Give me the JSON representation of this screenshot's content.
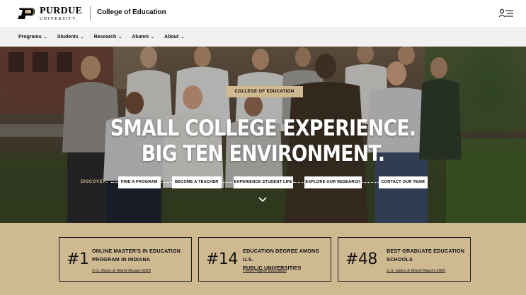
{
  "header": {
    "logo_word": "PURDUE",
    "logo_sub": "UNIVERSITY.",
    "college_name": "College of Education",
    "menu_icon": "user-menu-icon"
  },
  "nav": {
    "items": [
      {
        "label": "Programs"
      },
      {
        "label": "Students"
      },
      {
        "label": "Research"
      },
      {
        "label": "Alumni"
      },
      {
        "label": "About"
      }
    ]
  },
  "hero": {
    "badge": "COLLEGE OF EDUCATION",
    "headline_1": "SMALL COLLEGE EXPERIENCE.",
    "headline_2": "BIG TEN ENVIRONMENT.",
    "discover_label": "DISCOVER:",
    "ctas": [
      {
        "label": "FIND A PROGRAM"
      },
      {
        "label": "BECOME A TEACHER"
      },
      {
        "label": "EXPERIENCE STUDENT LIFE"
      },
      {
        "label": "EXPLORE OUR RESEARCH"
      },
      {
        "label": "CONTACT OUR TEAM"
      }
    ]
  },
  "stats": [
    {
      "number": "#1",
      "title_1": "ONLINE MASTER'S IN EDUCATION",
      "title_2": "PROGRAM IN INDIANA",
      "source": "U.S. News & World Report 2025"
    },
    {
      "number": "#14",
      "title_1": "EDUCATION DEGREE AMONG U.S.",
      "title_2": "PUBLIC UNIVERSITIES",
      "source": "Times Higher Education"
    },
    {
      "number": "#48",
      "title_1": "BEST GRADUATE EDUCATION",
      "title_2": "SCHOOLS",
      "source": "U.S. News & World Report 2025"
    }
  ],
  "colors": {
    "gold": "#cfb991",
    "nav_bg": "#f1f1f1",
    "text": "#111111"
  }
}
